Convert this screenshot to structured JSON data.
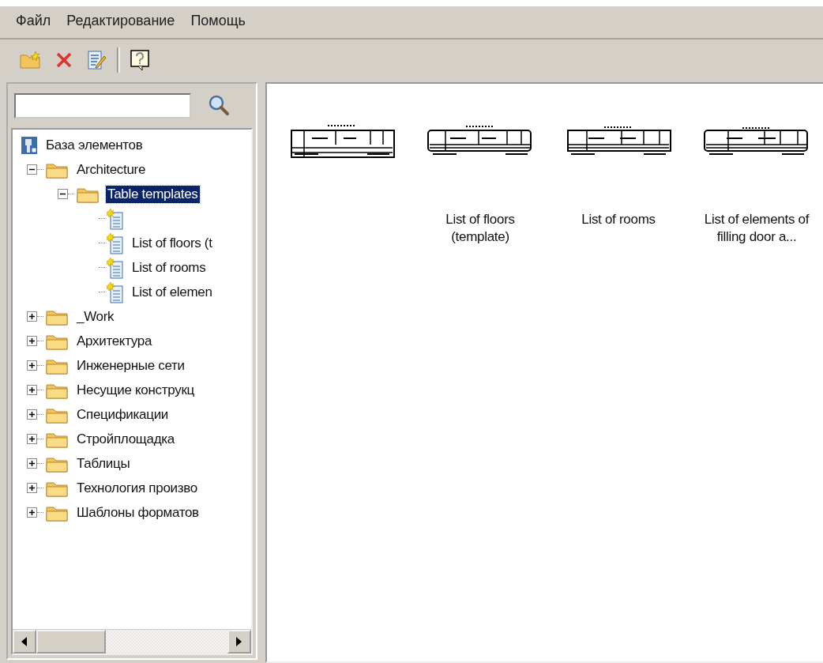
{
  "menu": [
    {
      "label": "Файл"
    },
    {
      "label": "Редактирование"
    },
    {
      "label": "Помощь"
    }
  ],
  "toolbar": [
    {
      "kind": "new-folder"
    },
    {
      "kind": "delete"
    },
    {
      "kind": "edit"
    },
    {
      "kind": "separator"
    },
    {
      "kind": "help"
    }
  ],
  "tree": {
    "label": "База элементов",
    "children": [
      {
        "label": "Architecture",
        "expanded": true,
        "selected": false,
        "children": [
          {
            "label": "Table templates",
            "expanded": true,
            "selected": true,
            "children": [
              {
                "kind": "template",
                "selected": false
              },
              {
                "kind": "template",
                "label": "List of floors (t",
                "selected": false
              },
              {
                "kind": "template",
                "label": "List of rooms",
                "selected": false
              },
              {
                "kind": "template",
                "label": "List of elemen",
                "selected": false
              }
            ]
          }
        ]
      },
      {
        "label": "_Work",
        "expanded": false,
        "selected": false
      },
      {
        "label": "Архитектура",
        "expanded": false,
        "selected": false
      },
      {
        "label": "Инженерные сети",
        "expanded": false,
        "selected": false
      },
      {
        "label": "Несущие конструкц",
        "expanded": false,
        "selected": false
      },
      {
        "label": "Спецификации",
        "expanded": false,
        "selected": false
      },
      {
        "label": "Стройплощадка",
        "expanded": false,
        "selected": false
      },
      {
        "label": "Таблицы",
        "expanded": false,
        "selected": false
      },
      {
        "label": "Технология произво",
        "expanded": false,
        "selected": false
      },
      {
        "label": "Шаблоны форматов",
        "expanded": false,
        "selected": false
      }
    ]
  },
  "gallery": [
    {
      "kind": "table"
    },
    {
      "kind": "table",
      "label": "List of floors (template)"
    },
    {
      "kind": "table",
      "label": "List of rooms"
    },
    {
      "kind": "table",
      "label": "List of elements of filling door a..."
    }
  ]
}
